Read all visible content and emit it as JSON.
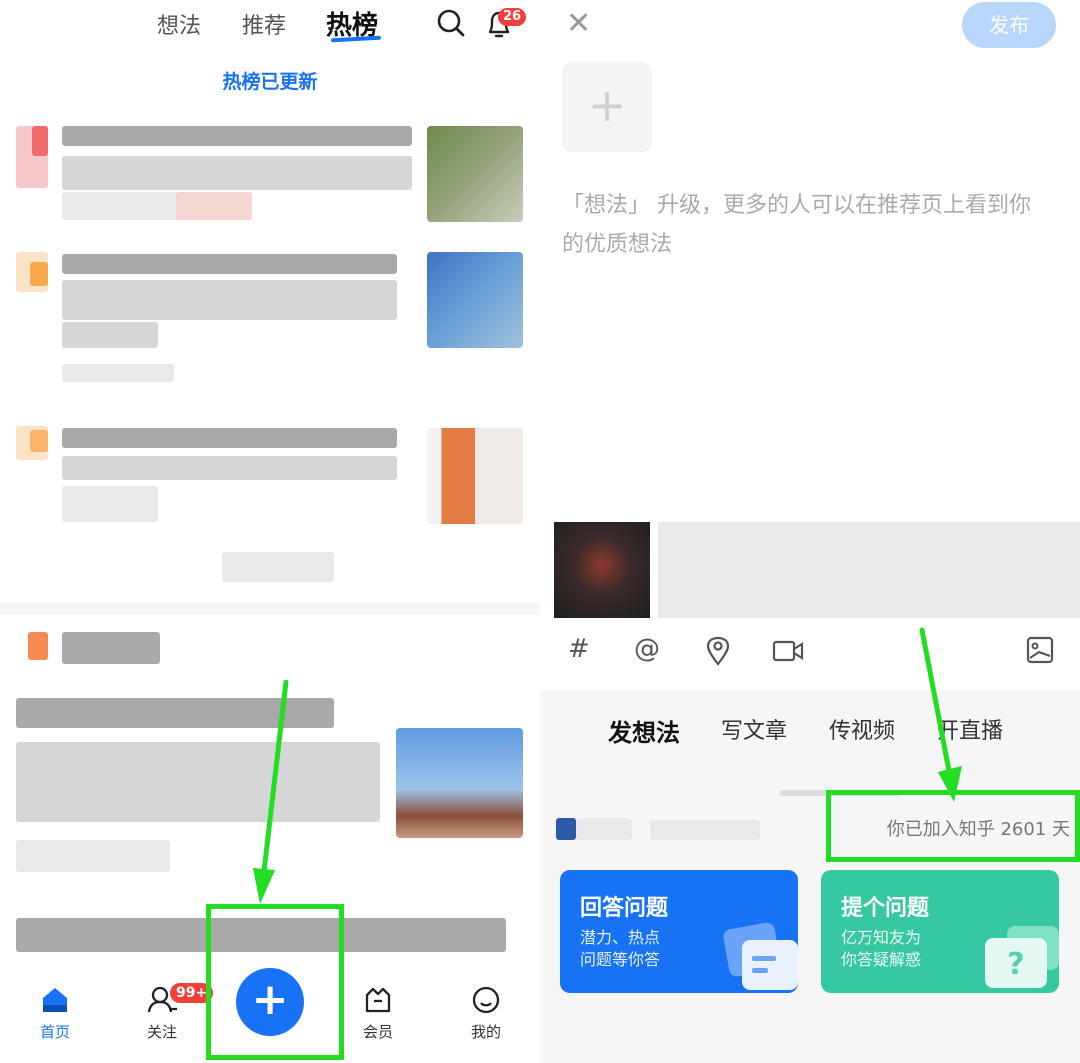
{
  "feed": {
    "tabs": [
      "想法",
      "推荐",
      "热榜"
    ],
    "active_tab": "热榜",
    "notification_count": "26",
    "updated_text": "热榜已更新",
    "nav": {
      "home": "首页",
      "follow": "关注",
      "follow_badge": "99+",
      "fab": "+",
      "vip": "会员",
      "me": "我的"
    }
  },
  "composer": {
    "close": "✕",
    "publish": "发布",
    "add": "+",
    "hint": "「想法」 升级，更多的人可以在推荐页上看到你的优质想法",
    "tools": [
      "#",
      "@"
    ],
    "modes": [
      "发想法",
      "写文章",
      "传视频",
      "开直播"
    ],
    "active_mode": "发想法",
    "joined_text": "你已加入知乎 2601 天",
    "cards": [
      {
        "title": "回答问题",
        "line1": "潜力、热点",
        "line2": "问题等你答",
        "color": "#1772f6"
      },
      {
        "title": "提个问题",
        "line1": "亿万知友为",
        "line2": "你答疑解惑",
        "color": "#36c8a1"
      }
    ]
  },
  "colors": {
    "brand": "#1772f6",
    "highlight": "#22dd22",
    "badge": "#f1403c"
  }
}
